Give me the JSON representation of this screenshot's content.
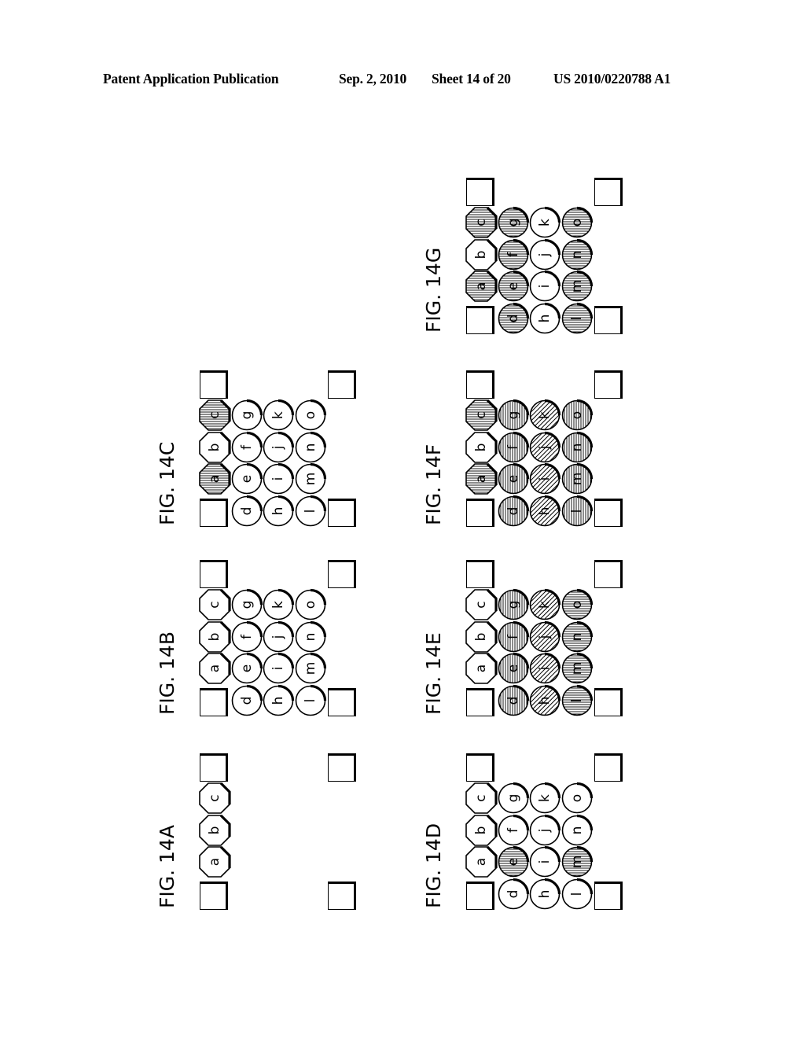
{
  "header": {
    "left": "Patent Application Publication",
    "date": "Sep. 2, 2010",
    "sheet": "Sheet 14 of 20",
    "number": "US 2010/0220788 A1"
  },
  "legend": {
    "shapes": {
      "octagon": "octagon-element",
      "circle": "circle-element",
      "square": "corner-square"
    },
    "hatch_types": [
      "none",
      "vertical",
      "horizontal",
      "diagonal"
    ]
  },
  "grid": {
    "octagon_column": [
      "c",
      "b",
      "a"
    ],
    "circle_columns": [
      [
        "g",
        "f",
        "e",
        "d"
      ],
      [
        "k",
        "j",
        "i",
        "h"
      ],
      [
        "o",
        "n",
        "m",
        "l"
      ]
    ]
  },
  "figures": [
    {
      "id": "14A",
      "label": "FIG. 14A",
      "show_circles": false,
      "hatch": {}
    },
    {
      "id": "14B",
      "label": "FIG. 14B",
      "show_circles": true,
      "hatch": {}
    },
    {
      "id": "14C",
      "label": "FIG. 14C",
      "show_circles": true,
      "hatch": {
        "a": "horizontal",
        "c": "horizontal"
      }
    },
    {
      "id": "14D",
      "label": "FIG. 14D",
      "show_circles": true,
      "hatch": {
        "e": "horizontal",
        "m": "horizontal"
      }
    },
    {
      "id": "14E",
      "label": "FIG. 14E",
      "show_circles": true,
      "hatch": {
        "d": "vertical",
        "e": "vertical",
        "f": "vertical",
        "g": "vertical",
        "h": "diagonal",
        "i": "diagonal",
        "j": "diagonal",
        "k": "diagonal",
        "l": "horizontal",
        "m": "horizontal",
        "n": "horizontal",
        "o": "horizontal"
      }
    },
    {
      "id": "14F",
      "label": "FIG. 14F",
      "show_circles": true,
      "hatch": {
        "a": "horizontal",
        "c": "horizontal",
        "d": "vertical",
        "e": "vertical",
        "f": "vertical",
        "g": "vertical",
        "h": "diagonal",
        "i": "diagonal",
        "j": "diagonal",
        "k": "diagonal",
        "l": "vertical",
        "m": "vertical",
        "n": "vertical",
        "o": "vertical"
      }
    },
    {
      "id": "14G",
      "label": "FIG. 14G",
      "show_circles": true,
      "hatch": {
        "a": "horizontal",
        "c": "horizontal",
        "d": "horizontal",
        "e": "horizontal",
        "f": "horizontal",
        "g": "horizontal",
        "l": "horizontal",
        "m": "horizontal",
        "n": "horizontal",
        "o": "horizontal"
      }
    }
  ]
}
